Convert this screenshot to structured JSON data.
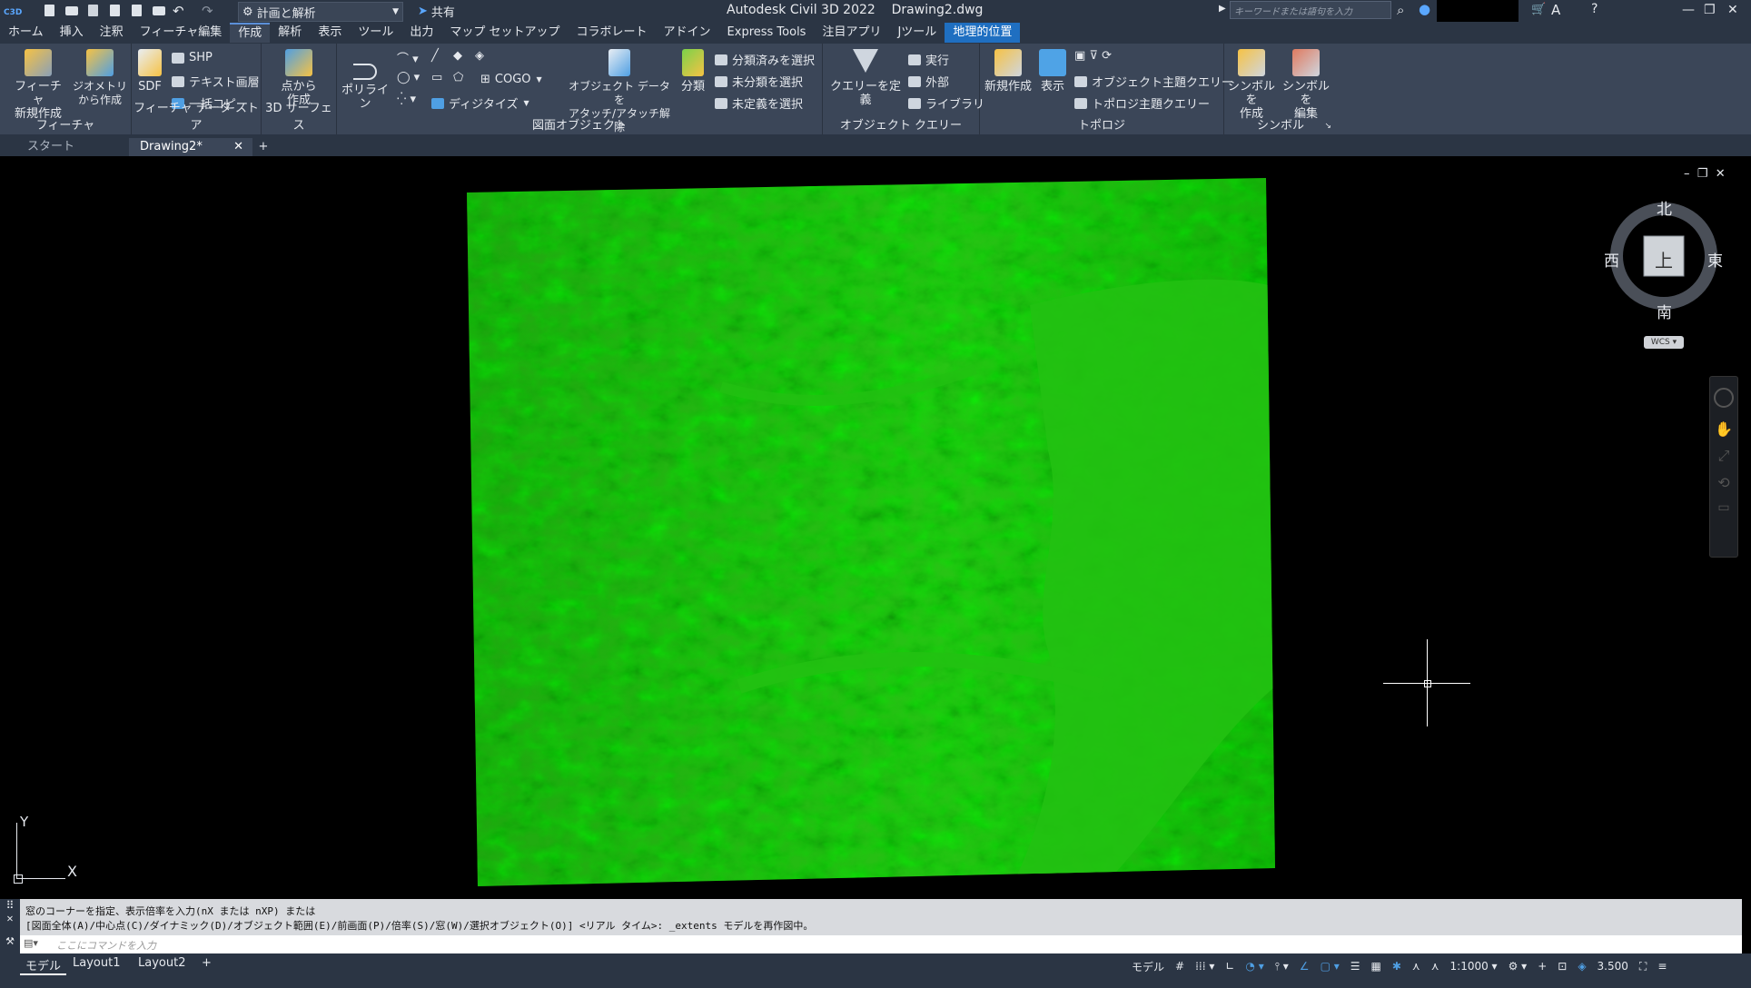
{
  "title_bar": {
    "app_logo": "C3D",
    "workspace": "計画と解析",
    "share": "共有",
    "app_name": "Autodesk Civil 3D 2022",
    "file_name": "Drawing2.dwg",
    "search_placeholder": "キーワードまたは語句を入力"
  },
  "menu_tabs": [
    "ホーム",
    "挿入",
    "注釈",
    "フィーチャ編集",
    "作成",
    "解析",
    "表示",
    "ツール",
    "出力",
    "マップ セットアップ",
    "コラボレート",
    "アドイン",
    "Express Tools",
    "注目アプリ",
    "Jツール",
    "地理的位置"
  ],
  "active_tab": "作成",
  "highlighted_tab": "地理的位置",
  "ribbon": {
    "feature": {
      "title": "フィーチャ",
      "new_btn": "フィーチャ\n新規作成",
      "geo_btn": "ジオメトリ\nから作成"
    },
    "feature_data_store": {
      "title": "フィーチャ データ ストア",
      "sdf": "SDF",
      "shp": "SHP",
      "text_layer": "テキスト画層",
      "bulk_copy": "一括コピー"
    },
    "surface_3d": {
      "title": "3D サーフェス",
      "from_points": "点から\n作成"
    },
    "drawing_objects": {
      "title": "図面オブジェクト",
      "polyline": "ポリライン",
      "cogo": "COGO",
      "digitize": "ディジタイズ",
      "attach": "オブジェクト データを\nアタッチ/アタッチ解除",
      "classify": "分類",
      "sel_classified": "分類済みを選択",
      "sel_unclassified": "未分類を選択",
      "sel_undefined": "未定義を選択"
    },
    "object_query": {
      "title": "オブジェクト クエリー",
      "define": "クエリーを定義",
      "execute": "実行",
      "external": "外部",
      "library": "ライブラリ"
    },
    "topology": {
      "title": "トポロジ",
      "new": "新規作成",
      "show": "表示",
      "obj_theme": "オブジェクト主題クエリー",
      "topo_theme": "トポロジ主題クエリー"
    },
    "symbol": {
      "title": "シンボル",
      "create": "シンボルを\n作成",
      "edit": "シンボルを\n編集"
    }
  },
  "doc_tabs": [
    {
      "label": "スタート"
    },
    {
      "label": "Drawing2*"
    }
  ],
  "viewcube": {
    "north": "北",
    "south": "南",
    "east": "東",
    "west": "西",
    "top": "上",
    "wcs": "WCS"
  },
  "ucs": {
    "x": "X",
    "y": "Y"
  },
  "command": {
    "line1": "窓のコーナーを指定、表示倍率を入力(nX または nXP) または",
    "line2": "[図面全体(A)/中心点(C)/ダイナミック(D)/オブジェクト範囲(E)/前画面(P)/倍率(S)/窓(W)/選択オブジェクト(O)] <リアル タイム>: _extents モデルを再作図中。",
    "input_placeholder": "ここにコマンドを入力"
  },
  "layout_tabs": [
    "モデル",
    "Layout1",
    "Layout2"
  ],
  "status": {
    "model": "モデル",
    "scale": "1:1000",
    "annotation_value": "3.500"
  },
  "colors": {
    "terrain": "#2ecc1a",
    "ribbon_bg": "#3b4658",
    "titlebar_bg": "#2b3544",
    "highlight_tab": "#1f6fc1"
  }
}
